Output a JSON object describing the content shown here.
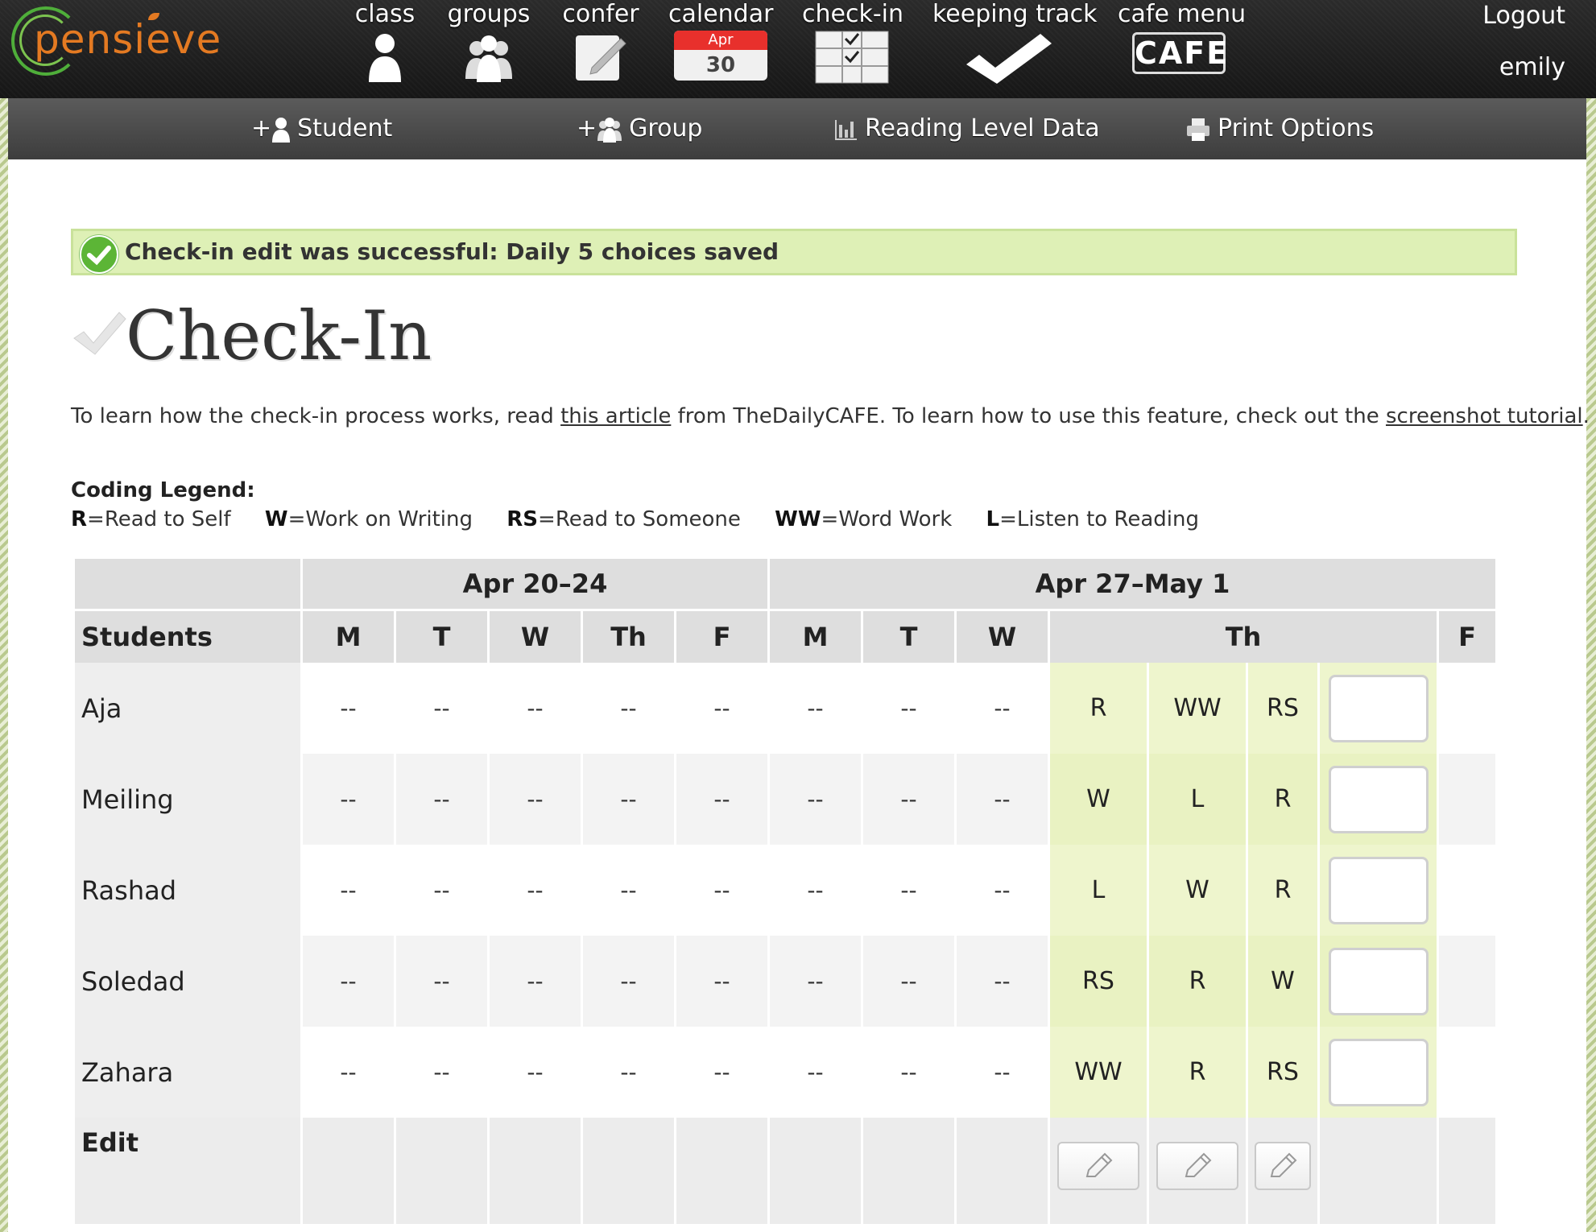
{
  "brand": {
    "logo_text": "pensieve",
    "logo_color": "#e47a22",
    "ring_color": "#4fae3a"
  },
  "nav": [
    {
      "label": "class",
      "icon": "student-icon"
    },
    {
      "label": "groups",
      "icon": "group-icon"
    },
    {
      "label": "confer",
      "icon": "pencil-note-icon"
    },
    {
      "label": "calendar",
      "icon": "calendar-icon",
      "month": "Apr",
      "day": "30"
    },
    {
      "label": "check-in",
      "icon": "checklist-icon"
    },
    {
      "label": "keeping track",
      "icon": "checkmark-icon"
    },
    {
      "label": "cafe menu",
      "icon": "cafe-icon",
      "badge": "CAFE"
    }
  ],
  "user": {
    "logout_label": "Logout",
    "name": "emily"
  },
  "subnav": [
    {
      "prefix": "+",
      "label": "Student",
      "icon": "student-icon"
    },
    {
      "prefix": "+",
      "label": "Group",
      "icon": "group-icon"
    },
    {
      "prefix": "",
      "label": "Reading Level Data",
      "icon": "bar-chart-icon"
    },
    {
      "prefix": "",
      "label": "Print Options",
      "icon": "printer-icon"
    }
  ],
  "alert": {
    "message": "Check-in edit was successful: Daily 5 choices saved",
    "color": "#def0b6"
  },
  "page": {
    "title": "Check-In",
    "intro_before": "To learn how the check-in process works, read ",
    "intro_link1": "this article",
    "intro_middle": " from TheDailyCAFE. To learn how to use this feature, check out the ",
    "intro_link2": "screenshot tutorial",
    "intro_after": "."
  },
  "legend": {
    "title": "Coding Legend:",
    "items": [
      {
        "code": "R",
        "meaning": "=Read to Self"
      },
      {
        "code": "W",
        "meaning": "=Work on Writing"
      },
      {
        "code": "RS",
        "meaning": "=Read to Someone"
      },
      {
        "code": "WW",
        "meaning": "=Word Work"
      },
      {
        "code": "L",
        "meaning": "=Listen to Reading"
      }
    ]
  },
  "table": {
    "weeks": [
      "Apr 20–24",
      "Apr 27–May 1"
    ],
    "students_header": "Students",
    "days_week1": [
      "M",
      "T",
      "W",
      "Th",
      "F"
    ],
    "days_week2": [
      "M",
      "T",
      "W",
      "Th",
      "F"
    ],
    "empty": "--",
    "rows": [
      {
        "name": "Aja",
        "th": [
          "R",
          "WW",
          "RS"
        ]
      },
      {
        "name": "Meiling",
        "th": [
          "W",
          "L",
          "R"
        ]
      },
      {
        "name": "Rashad",
        "th": [
          "L",
          "W",
          "R"
        ]
      },
      {
        "name": "Soledad",
        "th": [
          "RS",
          "R",
          "W"
        ]
      },
      {
        "name": "Zahara",
        "th": [
          "WW",
          "R",
          "RS"
        ]
      }
    ],
    "edit_label": "Edit"
  }
}
